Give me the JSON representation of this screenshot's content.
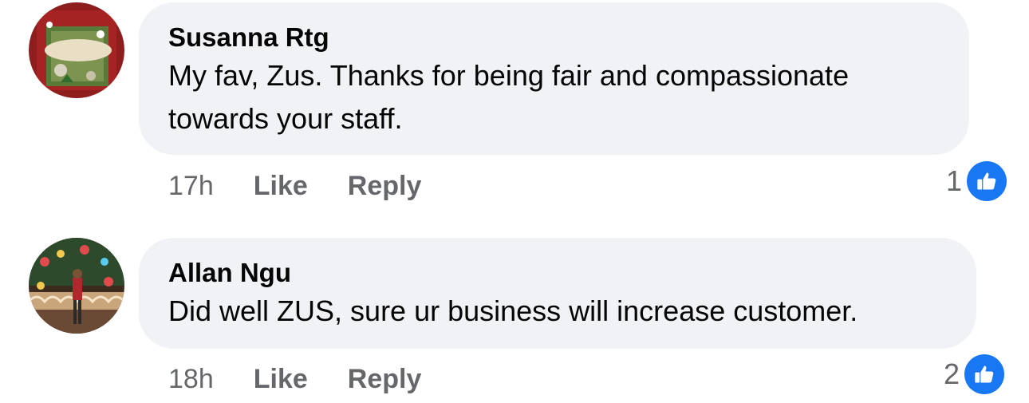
{
  "comments": [
    {
      "author": "Susanna Rtg",
      "text": "My fav, Zus. Thanks for being fair and compassionate towards your staff.",
      "time": "17h",
      "like_label": "Like",
      "reply_label": "Reply",
      "reaction_count": "1",
      "reaction_icon": "thumbs-up-icon"
    },
    {
      "author": "Allan Ngu",
      "text": "Did well ZUS, sure ur business will increase customer.",
      "time": "18h",
      "like_label": "Like",
      "reply_label": "Reply",
      "reaction_count": "2",
      "reaction_icon": "thumbs-up-icon"
    }
  ],
  "colors": {
    "bubble_bg": "#f0f2f5",
    "meta_text": "#65676b",
    "like_blue": "#1877f2"
  }
}
